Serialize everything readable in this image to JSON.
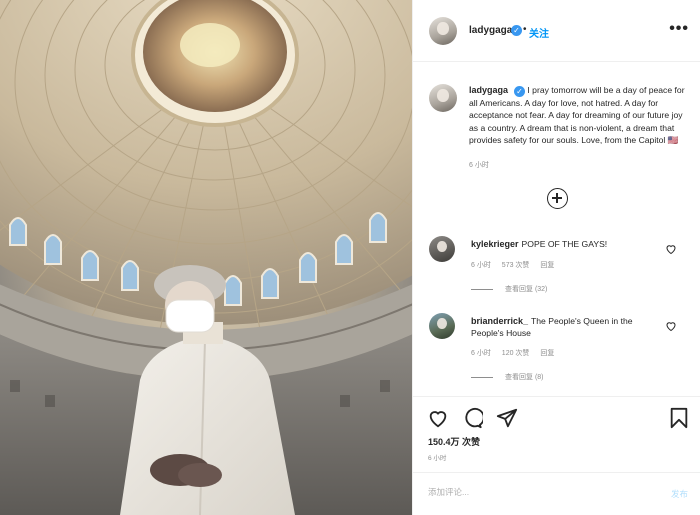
{
  "post": {
    "author": "ladygaga",
    "verified_mark": "✓",
    "separator": "•",
    "follow_label": "关注",
    "more_label": "•••",
    "caption": "I pray tomorrow will be a day of peace for all Americans. A day for love, not hatred. A day for acceptance not fear. A day for dreaming of our future joy as a country. A dream that is non-violent, a dream that provides safety for our souls. Love, from the Capitol 🇺🇸",
    "caption_time": "6 小时",
    "likes": "150.4万 次赞",
    "post_time": "6 小时"
  },
  "comments": [
    {
      "user": "kylekrieger",
      "text": "POPE OF THE GAYS!",
      "time": "6 小时",
      "likes": "573 次赞",
      "reply_label": "回复",
      "view_replies": "查看回复 (32)"
    },
    {
      "user": "brianderrick_",
      "text": "The People's Queen in the People's House",
      "time": "6 小时",
      "likes": "120 次赞",
      "reply_label": "回复",
      "view_replies": "查看回复 (8)"
    }
  ],
  "add_comment": {
    "placeholder": "添加评论...",
    "post_label": "发布"
  },
  "icons": {
    "like": "heart-icon",
    "comment": "comment-icon",
    "share": "send-icon",
    "save": "bookmark-icon",
    "load_more": "plus-circle-icon"
  },
  "colors": {
    "accent": "#0095f6",
    "verified": "#3897f0",
    "muted": "#8e8e8e"
  }
}
